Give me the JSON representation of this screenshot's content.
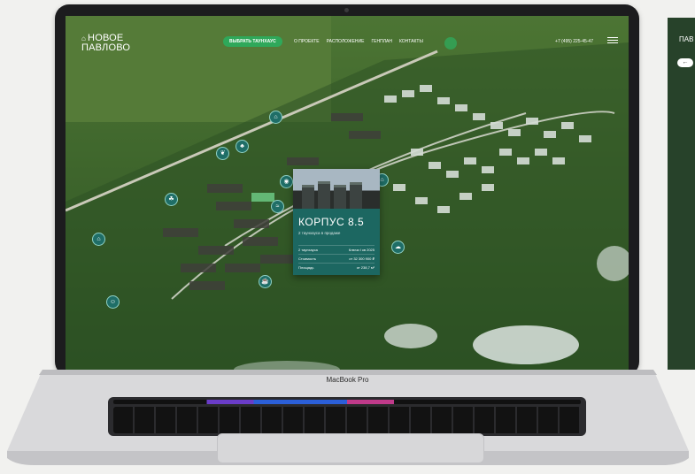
{
  "device": {
    "brand_label": "MacBook Pro"
  },
  "site": {
    "logo_icon": "⌂",
    "logo_line1": "НОВОЕ",
    "logo_line2": "ПАВЛОВО",
    "cta_label": "ВЫБРАТЬ ТАУНХАУС",
    "menu": [
      "О ПРОЕКТЕ",
      "РАСПОЛОЖЕНИЕ",
      "ГЕНПЛАН",
      "КОНТАКТЫ"
    ],
    "phone": "+7 (495) 225-45-47"
  },
  "card": {
    "title": "КОРПУС 8.5",
    "subtitle": "2 таунхауса в продаже",
    "rows": [
      {
        "label": "2 таунхауса",
        "value": "Ключи I кв 2025"
      },
      {
        "label": "Стоимость",
        "value": "от 32 300 900 ₽"
      },
      {
        "label": "Площадь",
        "value": "от 238,7 м²"
      }
    ]
  },
  "second_screen": {
    "logo_line1": "ПАВ",
    "back_arrow": "←"
  },
  "pins": [
    "house-icon",
    "tree-icon",
    "leaf-icon",
    "park-icon",
    "gate-icon",
    "playground-icon",
    "cafe-icon",
    "water-icon",
    "bench-icon",
    "sport-icon",
    "cloud-icon"
  ],
  "colors": {
    "accent": "#2fa85a",
    "card": "#1c6761",
    "pin": "#1f6e67"
  }
}
